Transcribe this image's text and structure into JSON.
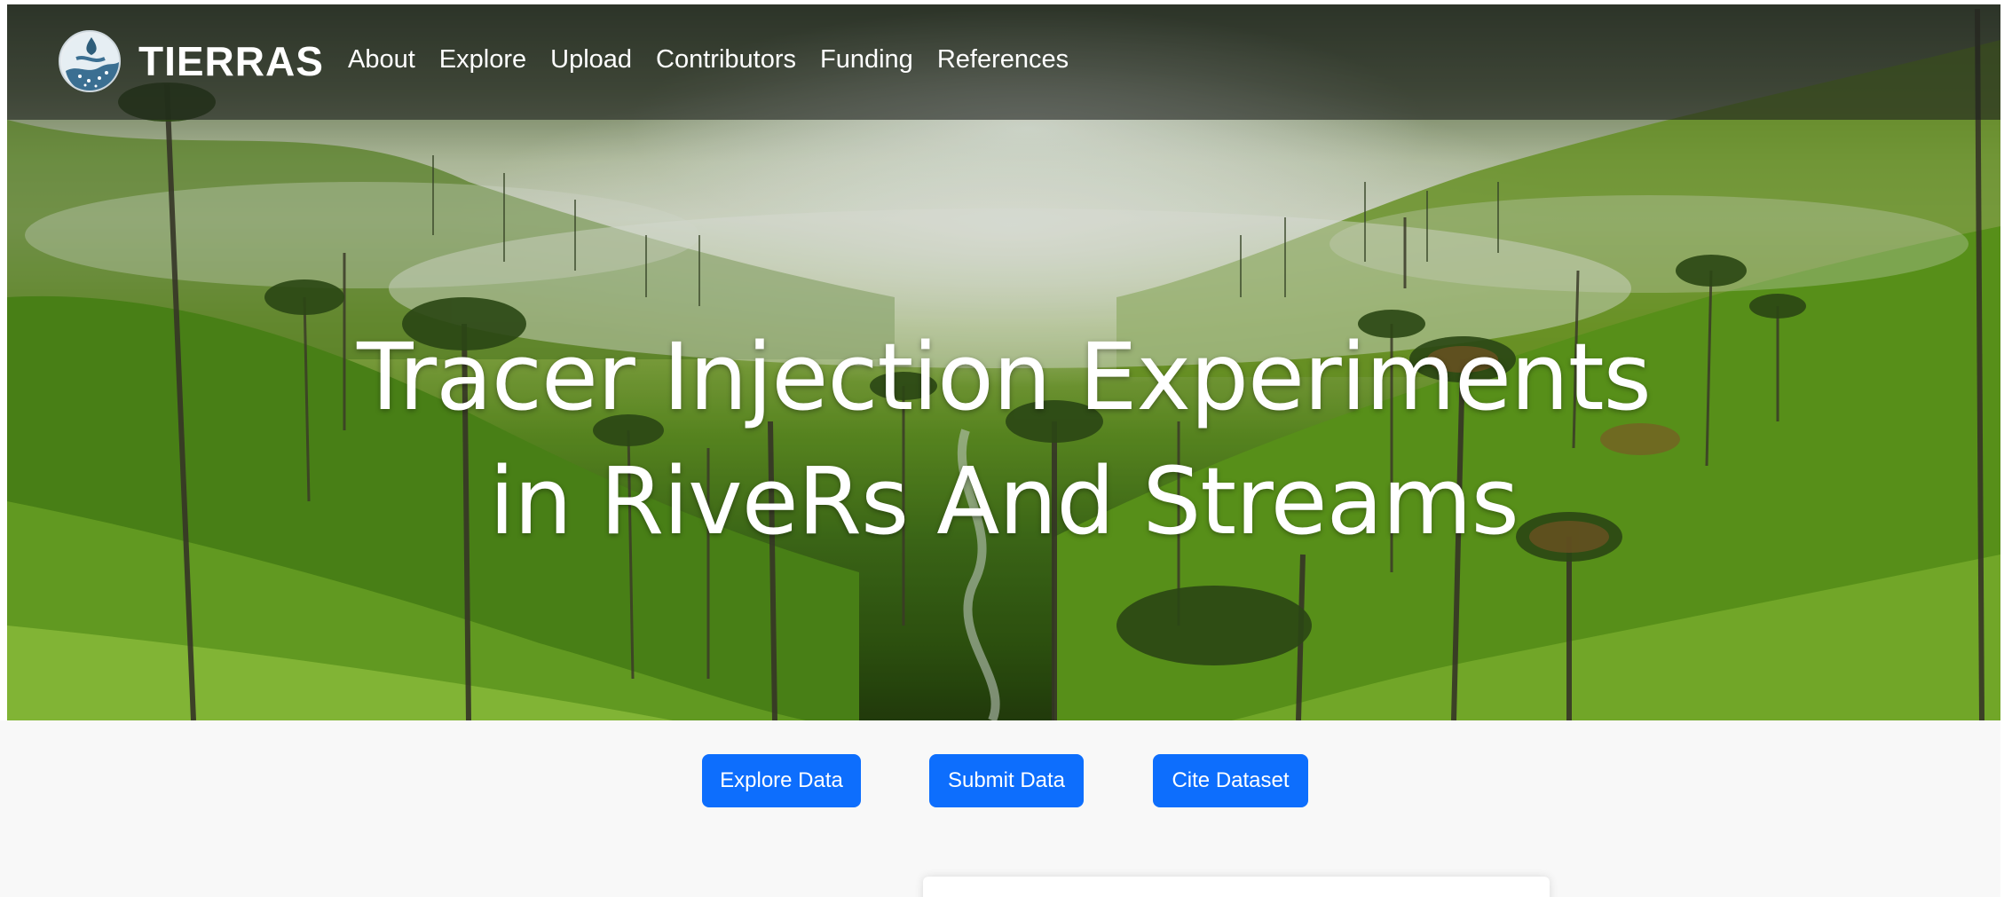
{
  "brand": {
    "name": "TIERRAS",
    "logo_icon": "river-drop-logo-icon"
  },
  "nav": {
    "items": [
      {
        "label": "About"
      },
      {
        "label": "Explore"
      },
      {
        "label": "Upload"
      },
      {
        "label": "Contributors"
      },
      {
        "label": "Funding"
      },
      {
        "label": "References"
      }
    ]
  },
  "hero": {
    "title_line1": "Tracer Injection Experiments",
    "title_line2": "in RiveRs And Streams"
  },
  "actions": {
    "explore_label": "Explore Data",
    "submit_label": "Submit Data",
    "cite_label": "Cite Dataset"
  },
  "colors": {
    "primary_button": "#0d6efd",
    "navbar_overlay": "rgba(30,34,30,0.62)",
    "page_background": "#f8f8f8"
  }
}
